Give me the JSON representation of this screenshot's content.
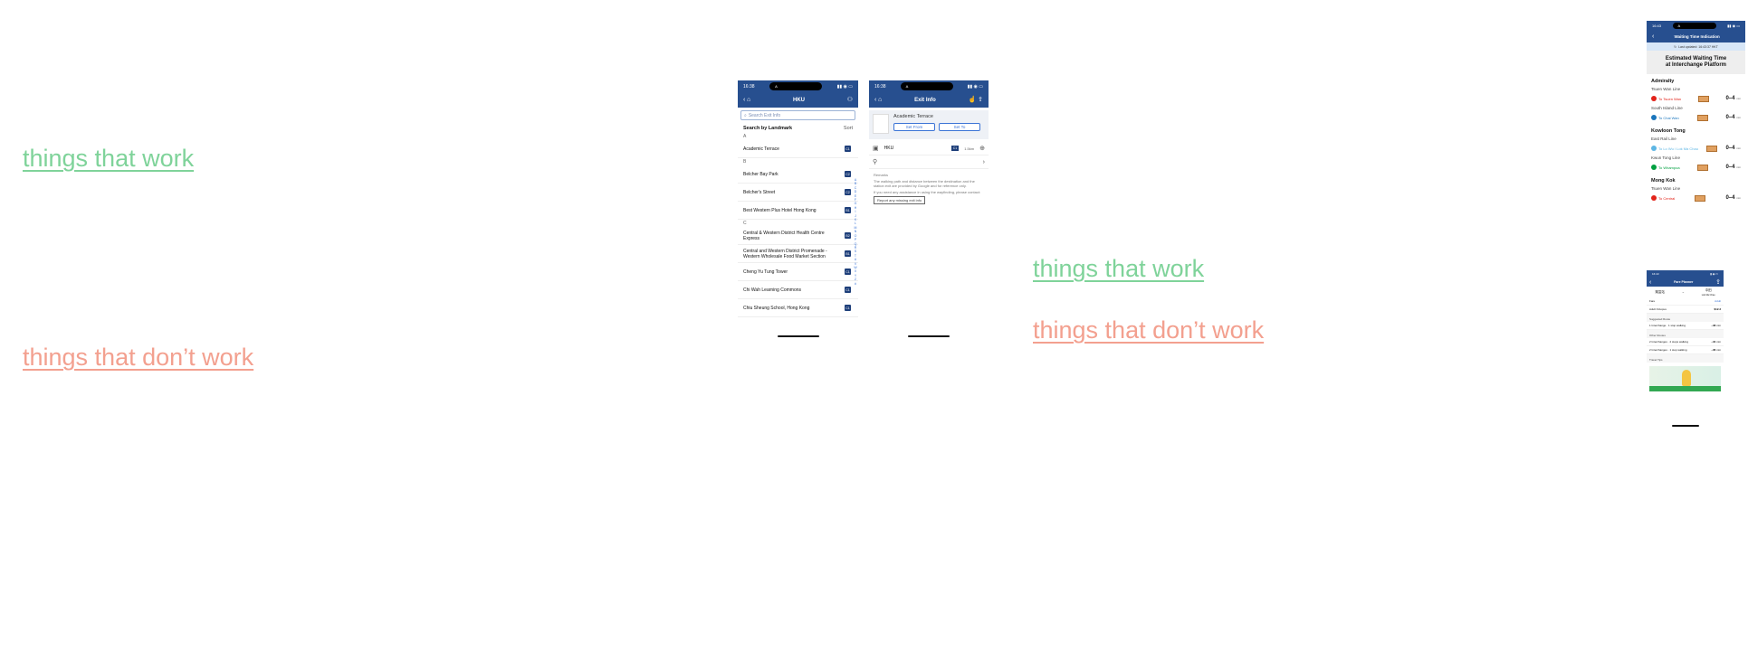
{
  "notes": {
    "left_good": "things that work",
    "left_bad": "things that don’t work",
    "mid_good": "things that work",
    "mid_bad": "things that don’t work"
  },
  "phone1": {
    "time": "16:38",
    "island_text": "A",
    "title": "HKU",
    "search_placeholder": "Search Exit Info",
    "section_title": "Search by Landmark",
    "sort_label": "Sort",
    "groups": [
      {
        "letter": "A",
        "items": [
          {
            "name": "Academic Terrace",
            "exit": "C1"
          }
        ]
      },
      {
        "letter": "B",
        "items": [
          {
            "name": "Belcher Bay Park",
            "exit": "C2"
          },
          {
            "name": "Belcher's Street",
            "exit": "C2"
          },
          {
            "name": "Best Western Plus Hotel Hong Kong",
            "exit": "B1"
          }
        ]
      },
      {
        "letter": "C",
        "items": [
          {
            "name": "Central & Western District Health Centre Express",
            "exit": "B2"
          },
          {
            "name": "Central and Western District Promenade - Western Wholesale Food Market Section",
            "exit": "B1"
          },
          {
            "name": "Cheng Yu Tung Tower",
            "exit": "C1"
          },
          {
            "name": "Chi Wah Learning Commons",
            "exit": "C1"
          },
          {
            "name": "Chiu Sheung School, Hong Kong",
            "exit": "C1"
          }
        ]
      }
    ],
    "az_index": "ABCDEFGHIJKLMNOPQRSTUVWXYZ#"
  },
  "phone2": {
    "time": "16:38",
    "island_text": "A",
    "title": "Exit Info",
    "poi_name": "Academic Terrace",
    "set_from": "Set From",
    "set_to": "Set To",
    "station": "HKU",
    "exit": "C1",
    "distance": "1.5km",
    "remarks_title": "Remarks",
    "remark_1": "The walking path and distance between the destination and the station exit are provided by Google and for reference only.",
    "remark_2": "If you need any assistance in using the wayfinding, please contact:",
    "report_button": "Report any missing exit info"
  },
  "phone3": {
    "time": "16:43",
    "island_text": "A",
    "title": "Waiting Time Indication",
    "last_updated": "Last updated: 16:43:37 HKT",
    "banner_line1": "Estimated Waiting Time",
    "banner_line2": "at Interchange Platform",
    "stations": [
      {
        "name": "Admiralty",
        "lines": [
          {
            "line": "Tsuen Wan Line",
            "dest": "To Tsuen Wan",
            "color": "#e2231a",
            "wait": "0–4"
          },
          {
            "line": "South Island Line",
            "dest": "To Chai Wan",
            "color": "#1a75bc",
            "wait": "0–4"
          }
        ]
      },
      {
        "name": "Kowloon Tong",
        "lines": [
          {
            "line": "East Rail Line",
            "dest": "To Lo Wu / Lok Ma Chau",
            "color": "#5eb6e4",
            "wait": "0–4"
          },
          {
            "line": "Kwun Tong Line",
            "dest": "To Whampoa",
            "color": "#00a040",
            "wait": "0–4"
          }
        ]
      },
      {
        "name": "Mong Kok",
        "lines": [
          {
            "line": "Tsuen Wan Line",
            "dest": "To Central",
            "color": "#e2231a",
            "wait": "0–4"
          }
        ]
      }
    ],
    "unit": "min"
  },
  "phone4": {
    "time": "16:43",
    "title": "Fare Planner",
    "from": "樂富站",
    "to": "中田",
    "to_sub": "Lok Ma Chau",
    "rows": [
      {
        "label": "Fare",
        "value": "Adult"
      },
      {
        "label": "Adult Octopus",
        "value": "$12.3"
      }
    ],
    "suggested": "Suggested Route",
    "option1": "1 Interchange · 1 stop walking",
    "option1_time": "~38",
    "other_routes": "Other Routes",
    "option2": "2 Interchanges · 2 stops walking",
    "option2_time": "~34",
    "option3": "2 Interchanges · 1 stop walking",
    "option3_time": "~36",
    "promo_heading": "Travel Tips",
    "unit": "min"
  }
}
